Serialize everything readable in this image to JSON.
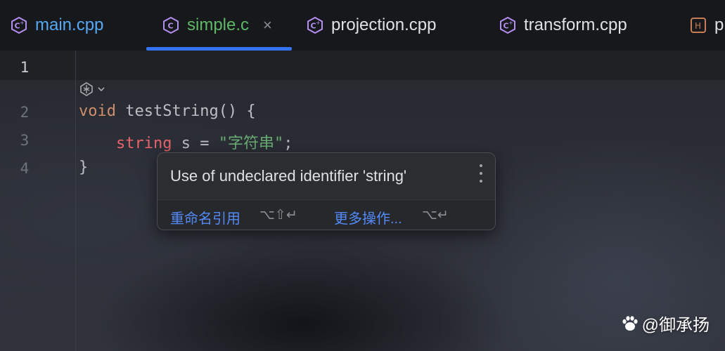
{
  "tabs": [
    {
      "label": "main.cpp",
      "icon": "cpp-file-icon",
      "color": "#56a8f5"
    },
    {
      "label": "simple.c",
      "icon": "c-file-icon",
      "color": "#5fb865",
      "active": true
    },
    {
      "label": "projection.cpp",
      "icon": "cpp-file-icon",
      "color": "#dfe1e5"
    },
    {
      "label": "transform.cpp",
      "icon": "cpp-file-icon",
      "color": "#dfe1e5"
    },
    {
      "label": "pi",
      "icon": "header-file-icon",
      "color": "#dfe1e5"
    }
  ],
  "tab_close_glyph": "×",
  "editor": {
    "line_numbers": [
      "1",
      "2",
      "3",
      "4"
    ],
    "line2": {
      "kw": "void",
      "name": "testString",
      "rest": "() {"
    },
    "line3": {
      "indent": "    ",
      "type": "string",
      "rest1": " s = ",
      "str": "\"字符串\"",
      "rest2": ";"
    },
    "line4": "}"
  },
  "popup": {
    "message": "Use of undeclared identifier 'string'",
    "action1": "重命名引用",
    "shortcut1": "⌥⇧↵",
    "action2": "更多操作...",
    "shortcut2": "⌥↵"
  },
  "watermark": "@御承扬",
  "colors": {
    "accent": "#3574f0",
    "keyword": "#cf8e6d",
    "type_error": "#e8646a",
    "string": "#6aab73",
    "link": "#548af7"
  }
}
